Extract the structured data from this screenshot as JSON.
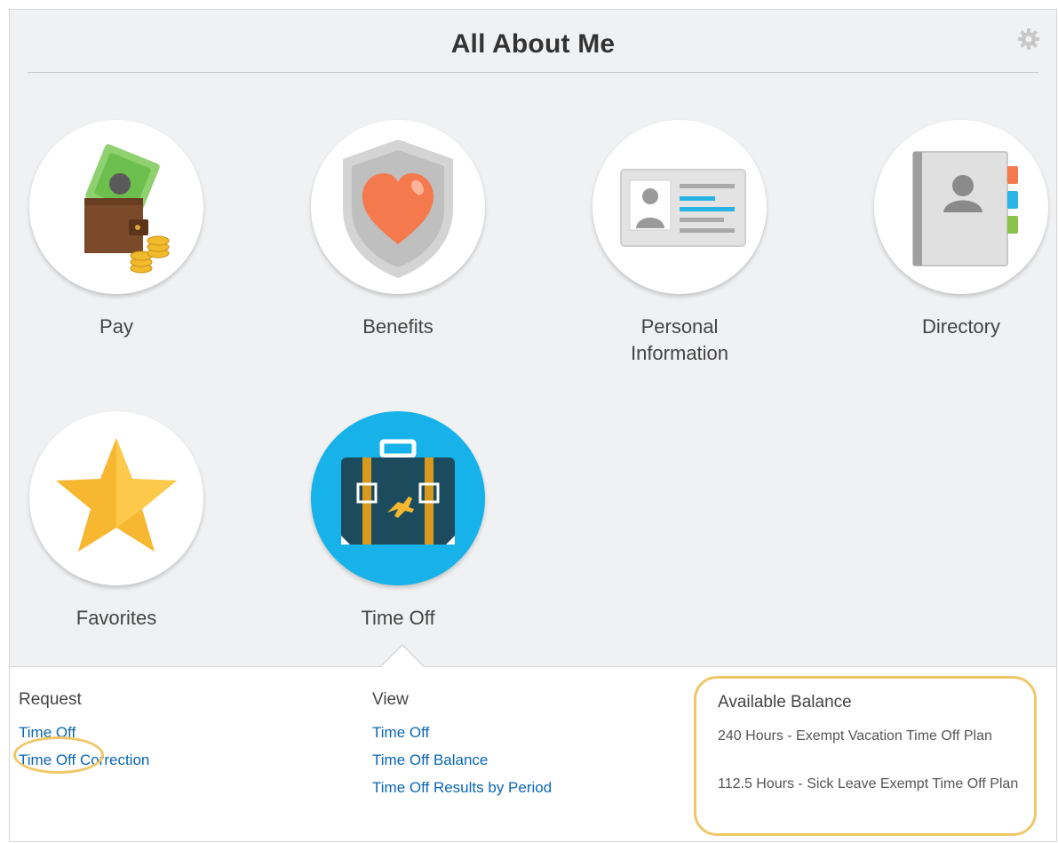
{
  "header": {
    "title": "All About Me",
    "settings_icon": "gear-icon"
  },
  "tiles": [
    {
      "label": "Pay",
      "icon": "wallet-icon"
    },
    {
      "label": "Benefits",
      "icon": "shield-heart-icon"
    },
    {
      "label": "Personal Information",
      "icon": "id-card-icon"
    },
    {
      "label": "Directory",
      "icon": "address-book-icon"
    },
    {
      "label": "Favorites",
      "icon": "star-icon"
    },
    {
      "label": "Time Off",
      "icon": "suitcase-icon",
      "selected": true
    }
  ],
  "details": {
    "request": {
      "heading": "Request",
      "links": [
        "Time Off",
        "Time Off Correction"
      ]
    },
    "view": {
      "heading": "View",
      "links": [
        "Time Off",
        "Time Off Balance",
        "Time Off Results by Period"
      ]
    },
    "balance": {
      "heading": "Available Balance",
      "items": [
        "240 Hours - Exempt Vacation Time Off Plan",
        "112.5 Hours - Sick Leave Exempt Time Off Plan"
      ]
    }
  },
  "colors": {
    "link": "#0a66b3",
    "highlight": "#f0c768",
    "active_tile": "#17b2ea",
    "panel_bg": "#f0f1f2"
  }
}
